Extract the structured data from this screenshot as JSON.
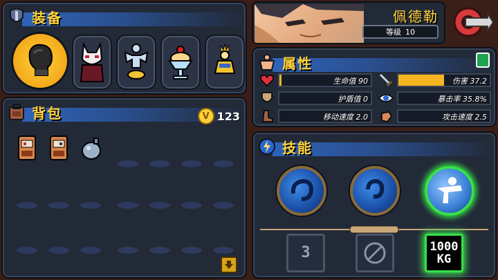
{
  "equipment": {
    "title": "装备"
  },
  "backpack": {
    "title": "背包",
    "coins": "123",
    "coin_symbol": "V"
  },
  "character": {
    "name": "佩德勒",
    "level_label": "等级",
    "level_value": "10"
  },
  "attributes": {
    "title": "属性",
    "stats": [
      {
        "label": "生命值",
        "value": "90",
        "icon": "heart-icon",
        "fill": 0.02
      },
      {
        "label": "伤害",
        "value": "37.2",
        "icon": "sword-icon",
        "fill": 0.5
      },
      {
        "label": "护盾值",
        "value": "0",
        "icon": "shield-icon",
        "fill": 0
      },
      {
        "label": "暴击率",
        "value": "35.8%",
        "icon": "eye-icon",
        "fill": 0
      },
      {
        "label": "移动速度",
        "value": "2.0",
        "icon": "boot-icon",
        "fill": 0
      },
      {
        "label": "攻击速度",
        "value": "2.5",
        "icon": "fist-icon",
        "fill": 0
      }
    ]
  },
  "skills": {
    "title": "技能",
    "passives": [
      {
        "text": "3"
      },
      {
        "text": ""
      },
      {
        "text": "1000\nKG"
      }
    ]
  },
  "colors": {
    "gold": "#ffd23a",
    "fill": "#f4b521",
    "active": "#38e04a"
  }
}
